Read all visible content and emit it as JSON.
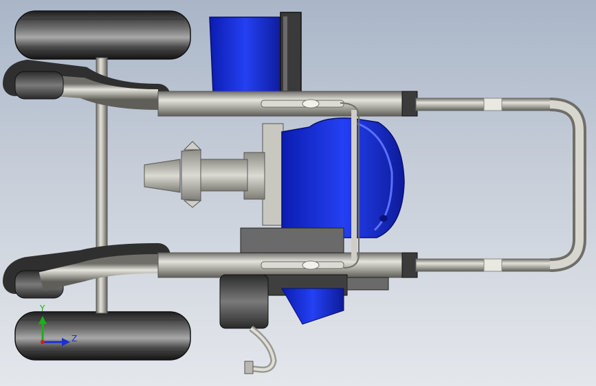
{
  "viewport": {
    "view": "cad-3d-model-view",
    "background_top": "#a9b6c8",
    "background_bottom": "#e4e7ec"
  },
  "model": {
    "parts": [
      "wheel",
      "wheel",
      "axle",
      "frame-rail",
      "frame-rail",
      "handle",
      "motor-housing",
      "pump-nozzle",
      "hose"
    ],
    "colors": {
      "steel": "#b9b8b1",
      "housing_blue": "#1c34e6",
      "tire_dark": "#2b2b2b",
      "dark_gray": "#4a4a4a"
    }
  },
  "triad": {
    "y_label": "Y",
    "z_label": "Z",
    "y_color": "#19b019",
    "z_color": "#1a2fd6",
    "x_color": "#d41c1c"
  }
}
